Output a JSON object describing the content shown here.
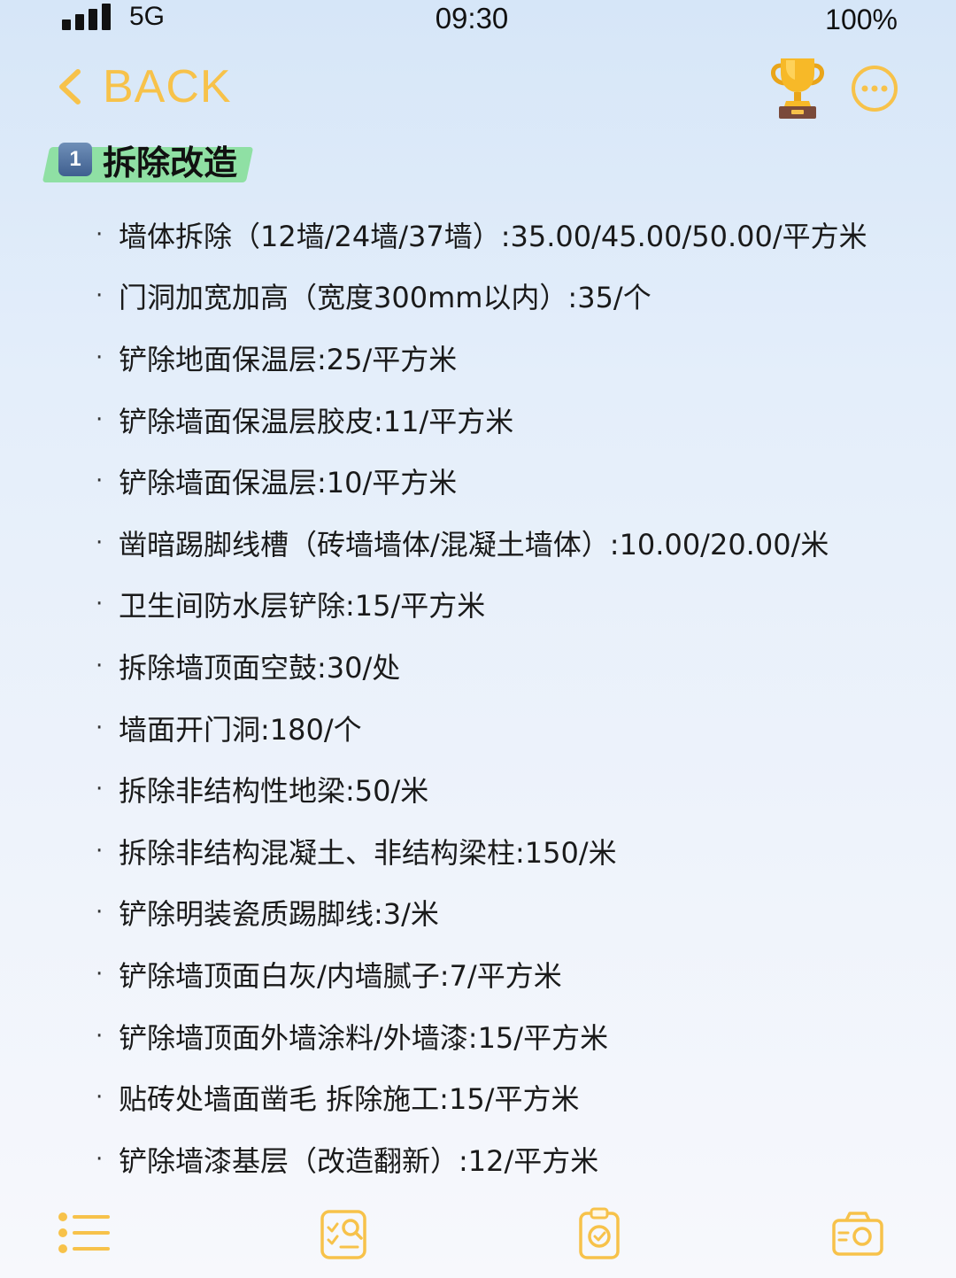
{
  "status_bar": {
    "network": "5G",
    "time": "09:30",
    "battery": "100%"
  },
  "nav": {
    "back_label": "BACK",
    "icons": [
      "chevron-left-icon",
      "trophy-icon",
      "more-icon"
    ]
  },
  "section": {
    "number": "1",
    "title": "拆除改造"
  },
  "items": [
    "墙体拆除（12墙/24墙/37墙）:35.00/45.00/50.00/平方米",
    "门洞加宽加高（宽度300mm以内）:35/个",
    "铲除地面保温层:25/平方米",
    "铲除墙面保温层胶皮:11/平方米",
    "铲除墙面保温层:10/平方米",
    "凿暗踢脚线槽（砖墙墙体/混凝土墙体）:10.00/20.00/米",
    "卫生间防水层铲除:15/平方米",
    "拆除墙顶面空鼓:30/处",
    "墙面开门洞:180/个",
    "拆除非结构性地梁:50/米",
    "拆除非结构混凝土、非结构梁柱:150/米",
    "铲除明装瓷质踢脚线:3/米",
    "铲除墙顶面白灰/内墙腻子:7/平方米",
    "铲除墙顶面外墙涂料/外墙漆:15/平方米",
    "贴砖处墙面凿毛 拆除施工:15/平方米",
    "铲除墙漆基层（改造翻新）:12/平方米"
  ],
  "bullet": "·",
  "toolbar": {
    "icons": [
      "list-icon",
      "search-checklist-icon",
      "clipboard-check-icon",
      "camera-icon"
    ]
  },
  "colors": {
    "accent": "#f7c24a",
    "heading_highlight": "#8fe0a4",
    "background_top": "#d6e6f8",
    "background_bottom": "#f7f8fc"
  }
}
